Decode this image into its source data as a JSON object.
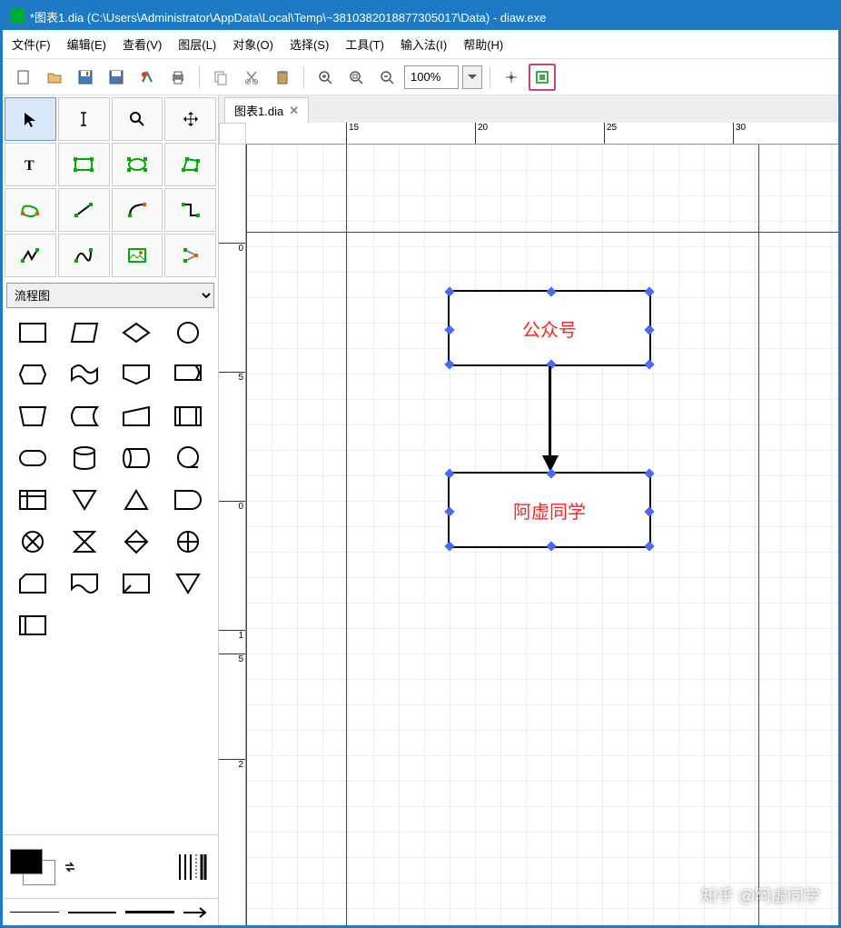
{
  "window": {
    "title": "*图表1.dia (C:\\Users\\Administrator\\AppData\\Local\\Temp\\~3810382018877305017\\Data) - diaw.exe"
  },
  "menu": {
    "file": "文件(F)",
    "edit": "编辑(E)",
    "view": "查看(V)",
    "layers": "图层(L)",
    "objects": "对象(O)",
    "select": "选择(S)",
    "tools": "工具(T)",
    "input": "输入法(I)",
    "help": "帮助(H)"
  },
  "toolbar": {
    "zoom_value": "100%"
  },
  "tab": {
    "label": "图表1.dia"
  },
  "sidebar": {
    "category": "流程图"
  },
  "ruler_h": [
    "15",
    "20",
    "25",
    "30"
  ],
  "ruler_v": [
    "0",
    "5",
    "0",
    "1",
    "5",
    "2"
  ],
  "shapes": {
    "box1_text": "公众号",
    "box2_text": "阿虚同学"
  },
  "watermark": "知乎 @阿虚同学"
}
